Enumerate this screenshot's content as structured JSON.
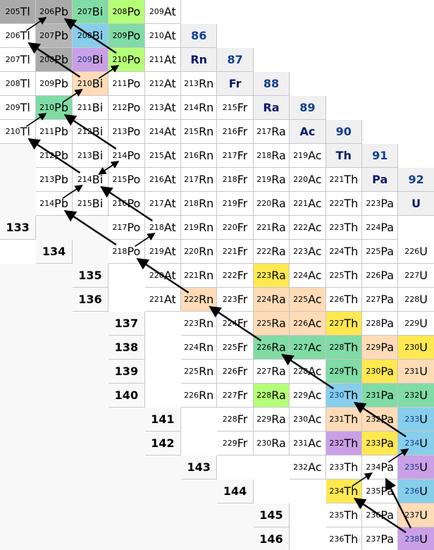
{
  "colors": {
    "stable_gray": "#aaaaaa",
    "stable_inner": "#b5b5b5",
    "beta_minus_blue": "#87ceeb",
    "alpha_yellow": "#fff06f",
    "beta_yellow": "#ffe850",
    "green_long": "#80dba5",
    "green_light": "#b6ff78",
    "orange": "#ffdbb7",
    "purple": "#c9a0e6",
    "header_bg": "#f0f0f0",
    "neutron_bg": "#f8f8f8",
    "proton_number": "#103f91"
  },
  "proton_headers": [
    {
      "z": "86",
      "symbol": "Rn"
    },
    {
      "z": "87",
      "symbol": "Fr"
    },
    {
      "z": "88",
      "symbol": "Ra"
    },
    {
      "z": "89",
      "symbol": "Ac"
    },
    {
      "z": "90",
      "symbol": "Th"
    },
    {
      "z": "91",
      "symbol": "Pa"
    },
    {
      "z": "92",
      "symbol": "U"
    }
  ],
  "neutron_headers": [
    "133",
    "134",
    "135",
    "136",
    "137",
    "138",
    "139",
    "140",
    "141",
    "142",
    "143",
    "144",
    "145",
    "146"
  ],
  "nuclides": [
    {
      "m": "205",
      "s": "Tl",
      "c": "stable_gray"
    },
    {
      "m": "206",
      "s": "Pb",
      "c": "stable_gray"
    },
    {
      "m": "207",
      "s": "Bi",
      "c": "green_long"
    },
    {
      "m": "208",
      "s": "Po",
      "c": "green_light"
    },
    {
      "m": "209",
      "s": "At",
      "c": ""
    },
    {
      "m": "206",
      "s": "Tl",
      "c": ""
    },
    {
      "m": "207",
      "s": "Pb",
      "c": "stable_inner"
    },
    {
      "m": "208",
      "s": "Bi",
      "c": "beta_minus_blue"
    },
    {
      "m": "209",
      "s": "Po",
      "c": "green_long"
    },
    {
      "m": "210",
      "s": "At",
      "c": ""
    },
    {
      "m": "207",
      "s": "Tl",
      "c": ""
    },
    {
      "m": "208",
      "s": "Pb",
      "c": "stable_gray"
    },
    {
      "m": "209",
      "s": "Bi",
      "c": "purple"
    },
    {
      "m": "210",
      "s": "Po",
      "c": "green_light"
    },
    {
      "m": "211",
      "s": "At",
      "c": ""
    },
    {
      "m": "208",
      "s": "Tl",
      "c": ""
    },
    {
      "m": "209",
      "s": "Pb",
      "c": ""
    },
    {
      "m": "210",
      "s": "Bi",
      "c": "orange"
    },
    {
      "m": "211",
      "s": "Po",
      "c": ""
    },
    {
      "m": "212",
      "s": "At",
      "c": ""
    },
    {
      "m": "213",
      "s": "Rn",
      "c": ""
    },
    {
      "m": "209",
      "s": "Tl",
      "c": ""
    },
    {
      "m": "210",
      "s": "Pb",
      "c": "green_long"
    },
    {
      "m": "211",
      "s": "Bi",
      "c": ""
    },
    {
      "m": "212",
      "s": "Po",
      "c": ""
    },
    {
      "m": "213",
      "s": "At",
      "c": ""
    },
    {
      "m": "214",
      "s": "Rn",
      "c": ""
    },
    {
      "m": "215",
      "s": "Fr",
      "c": ""
    },
    {
      "m": "210",
      "s": "Tl",
      "c": ""
    },
    {
      "m": "211",
      "s": "Pb",
      "c": ""
    },
    {
      "m": "212",
      "s": "Bi",
      "c": ""
    },
    {
      "m": "213",
      "s": "Po",
      "c": ""
    },
    {
      "m": "214",
      "s": "At",
      "c": ""
    },
    {
      "m": "215",
      "s": "Rn",
      "c": ""
    },
    {
      "m": "216",
      "s": "Fr",
      "c": ""
    },
    {
      "m": "217",
      "s": "Ra",
      "c": ""
    },
    {
      "m": "212",
      "s": "Pb",
      "c": ""
    },
    {
      "m": "213",
      "s": "Bi",
      "c": ""
    },
    {
      "m": "214",
      "s": "Po",
      "c": ""
    },
    {
      "m": "215",
      "s": "At",
      "c": ""
    },
    {
      "m": "216",
      "s": "Rn",
      "c": ""
    },
    {
      "m": "217",
      "s": "Fr",
      "c": ""
    },
    {
      "m": "218",
      "s": "Ra",
      "c": ""
    },
    {
      "m": "219",
      "s": "Ac",
      "c": ""
    },
    {
      "m": "213",
      "s": "Pb",
      "c": ""
    },
    {
      "m": "214",
      "s": "Bi",
      "c": ""
    },
    {
      "m": "215",
      "s": "Po",
      "c": ""
    },
    {
      "m": "216",
      "s": "At",
      "c": ""
    },
    {
      "m": "217",
      "s": "Rn",
      "c": ""
    },
    {
      "m": "218",
      "s": "Fr",
      "c": ""
    },
    {
      "m": "219",
      "s": "Ra",
      "c": ""
    },
    {
      "m": "220",
      "s": "Ac",
      "c": ""
    },
    {
      "m": "221",
      "s": "Th",
      "c": ""
    },
    {
      "m": "214",
      "s": "Pb",
      "c": ""
    },
    {
      "m": "215",
      "s": "Bi",
      "c": ""
    },
    {
      "m": "216",
      "s": "Po",
      "c": ""
    },
    {
      "m": "217",
      "s": "At",
      "c": ""
    },
    {
      "m": "218",
      "s": "Rn",
      "c": ""
    },
    {
      "m": "219",
      "s": "Fr",
      "c": ""
    },
    {
      "m": "220",
      "s": "Ra",
      "c": ""
    },
    {
      "m": "221",
      "s": "Ac",
      "c": ""
    },
    {
      "m": "222",
      "s": "Th",
      "c": ""
    },
    {
      "m": "223",
      "s": "Pa",
      "c": ""
    },
    {
      "m": "217",
      "s": "Po",
      "c": ""
    },
    {
      "m": "218",
      "s": "At",
      "c": ""
    },
    {
      "m": "219",
      "s": "Rn",
      "c": ""
    },
    {
      "m": "220",
      "s": "Fr",
      "c": ""
    },
    {
      "m": "221",
      "s": "Ra",
      "c": ""
    },
    {
      "m": "222",
      "s": "Ac",
      "c": ""
    },
    {
      "m": "223",
      "s": "Th",
      "c": ""
    },
    {
      "m": "224",
      "s": "Pa",
      "c": ""
    },
    {
      "m": "218",
      "s": "Po",
      "c": ""
    },
    {
      "m": "219",
      "s": "At",
      "c": ""
    },
    {
      "m": "220",
      "s": "Rn",
      "c": ""
    },
    {
      "m": "221",
      "s": "Fr",
      "c": ""
    },
    {
      "m": "222",
      "s": "Ra",
      "c": ""
    },
    {
      "m": "223",
      "s": "Ac",
      "c": ""
    },
    {
      "m": "224",
      "s": "Th",
      "c": ""
    },
    {
      "m": "225",
      "s": "Pa",
      "c": ""
    },
    {
      "m": "226",
      "s": "U",
      "c": ""
    },
    {
      "m": "220",
      "s": "At",
      "c": ""
    },
    {
      "m": "221",
      "s": "Rn",
      "c": ""
    },
    {
      "m": "222",
      "s": "Fr",
      "c": ""
    },
    {
      "m": "223",
      "s": "Ra",
      "c": "beta_yellow"
    },
    {
      "m": "224",
      "s": "Ac",
      "c": ""
    },
    {
      "m": "225",
      "s": "Th",
      "c": ""
    },
    {
      "m": "226",
      "s": "Pa",
      "c": ""
    },
    {
      "m": "227",
      "s": "U",
      "c": ""
    },
    {
      "m": "221",
      "s": "At",
      "c": ""
    },
    {
      "m": "222",
      "s": "Rn",
      "c": "orange"
    },
    {
      "m": "223",
      "s": "Fr",
      "c": ""
    },
    {
      "m": "224",
      "s": "Ra",
      "c": "orange"
    },
    {
      "m": "225",
      "s": "Ac",
      "c": "orange"
    },
    {
      "m": "226",
      "s": "Th",
      "c": ""
    },
    {
      "m": "227",
      "s": "Pa",
      "c": ""
    },
    {
      "m": "228",
      "s": "U",
      "c": ""
    },
    {
      "m": "223",
      "s": "Rn",
      "c": ""
    },
    {
      "m": "224",
      "s": "Fr",
      "c": ""
    },
    {
      "m": "225",
      "s": "Ra",
      "c": "orange"
    },
    {
      "m": "226",
      "s": "Ac",
      "c": "orange"
    },
    {
      "m": "227",
      "s": "Th",
      "c": "beta_yellow"
    },
    {
      "m": "228",
      "s": "Pa",
      "c": ""
    },
    {
      "m": "229",
      "s": "U",
      "c": ""
    },
    {
      "m": "224",
      "s": "Rn",
      "c": ""
    },
    {
      "m": "225",
      "s": "Fr",
      "c": ""
    },
    {
      "m": "226",
      "s": "Ra",
      "c": "green_long"
    },
    {
      "m": "227",
      "s": "Ac",
      "c": "green_long"
    },
    {
      "m": "228",
      "s": "Th",
      "c": "green_long"
    },
    {
      "m": "229",
      "s": "Pa",
      "c": "orange"
    },
    {
      "m": "230",
      "s": "U",
      "c": "beta_yellow"
    },
    {
      "m": "225",
      "s": "Rn",
      "c": ""
    },
    {
      "m": "226",
      "s": "Fr",
      "c": ""
    },
    {
      "m": "227",
      "s": "Ra",
      "c": ""
    },
    {
      "m": "228",
      "s": "Ac",
      "c": ""
    },
    {
      "m": "229",
      "s": "Th",
      "c": "green_long"
    },
    {
      "m": "230",
      "s": "Pa",
      "c": "beta_yellow"
    },
    {
      "m": "231",
      "s": "U",
      "c": "orange"
    },
    {
      "m": "226",
      "s": "Rn",
      "c": ""
    },
    {
      "m": "227",
      "s": "Fr",
      "c": ""
    },
    {
      "m": "228",
      "s": "Ra",
      "c": "green_light"
    },
    {
      "m": "229",
      "s": "Ac",
      "c": ""
    },
    {
      "m": "230",
      "s": "Th",
      "c": "beta_minus_blue"
    },
    {
      "m": "231",
      "s": "Pa",
      "c": "green_long"
    },
    {
      "m": "232",
      "s": "U",
      "c": "green_long"
    },
    {
      "m": "228",
      "s": "Fr",
      "c": ""
    },
    {
      "m": "229",
      "s": "Ra",
      "c": ""
    },
    {
      "m": "230",
      "s": "Ac",
      "c": ""
    },
    {
      "m": "231",
      "s": "Th",
      "c": "orange"
    },
    {
      "m": "232",
      "s": "Pa",
      "c": "orange"
    },
    {
      "m": "233",
      "s": "U",
      "c": "beta_minus_blue"
    },
    {
      "m": "229",
      "s": "Fr",
      "c": ""
    },
    {
      "m": "230",
      "s": "Ra",
      "c": ""
    },
    {
      "m": "231",
      "s": "Ac",
      "c": ""
    },
    {
      "m": "232",
      "s": "Th",
      "c": "purple"
    },
    {
      "m": "233",
      "s": "Pa",
      "c": "beta_yellow"
    },
    {
      "m": "234",
      "s": "U",
      "c": "beta_minus_blue"
    },
    {
      "m": "232",
      "s": "Ac",
      "c": ""
    },
    {
      "m": "233",
      "s": "Th",
      "c": ""
    },
    {
      "m": "234",
      "s": "Pa",
      "c": ""
    },
    {
      "m": "235",
      "s": "U",
      "c": "purple"
    },
    {
      "m": "234",
      "s": "Th",
      "c": "beta_yellow"
    },
    {
      "m": "235",
      "s": "Pa",
      "c": ""
    },
    {
      "m": "236",
      "s": "U",
      "c": "beta_minus_blue"
    },
    {
      "m": "235",
      "s": "Th",
      "c": ""
    },
    {
      "m": "236",
      "s": "Pa",
      "c": ""
    },
    {
      "m": "237",
      "s": "U",
      "c": "orange"
    },
    {
      "m": "236",
      "s": "Th",
      "c": ""
    },
    {
      "m": "237",
      "s": "Pa",
      "c": ""
    },
    {
      "m": "238",
      "s": "U",
      "c": "purple"
    }
  ]
}
